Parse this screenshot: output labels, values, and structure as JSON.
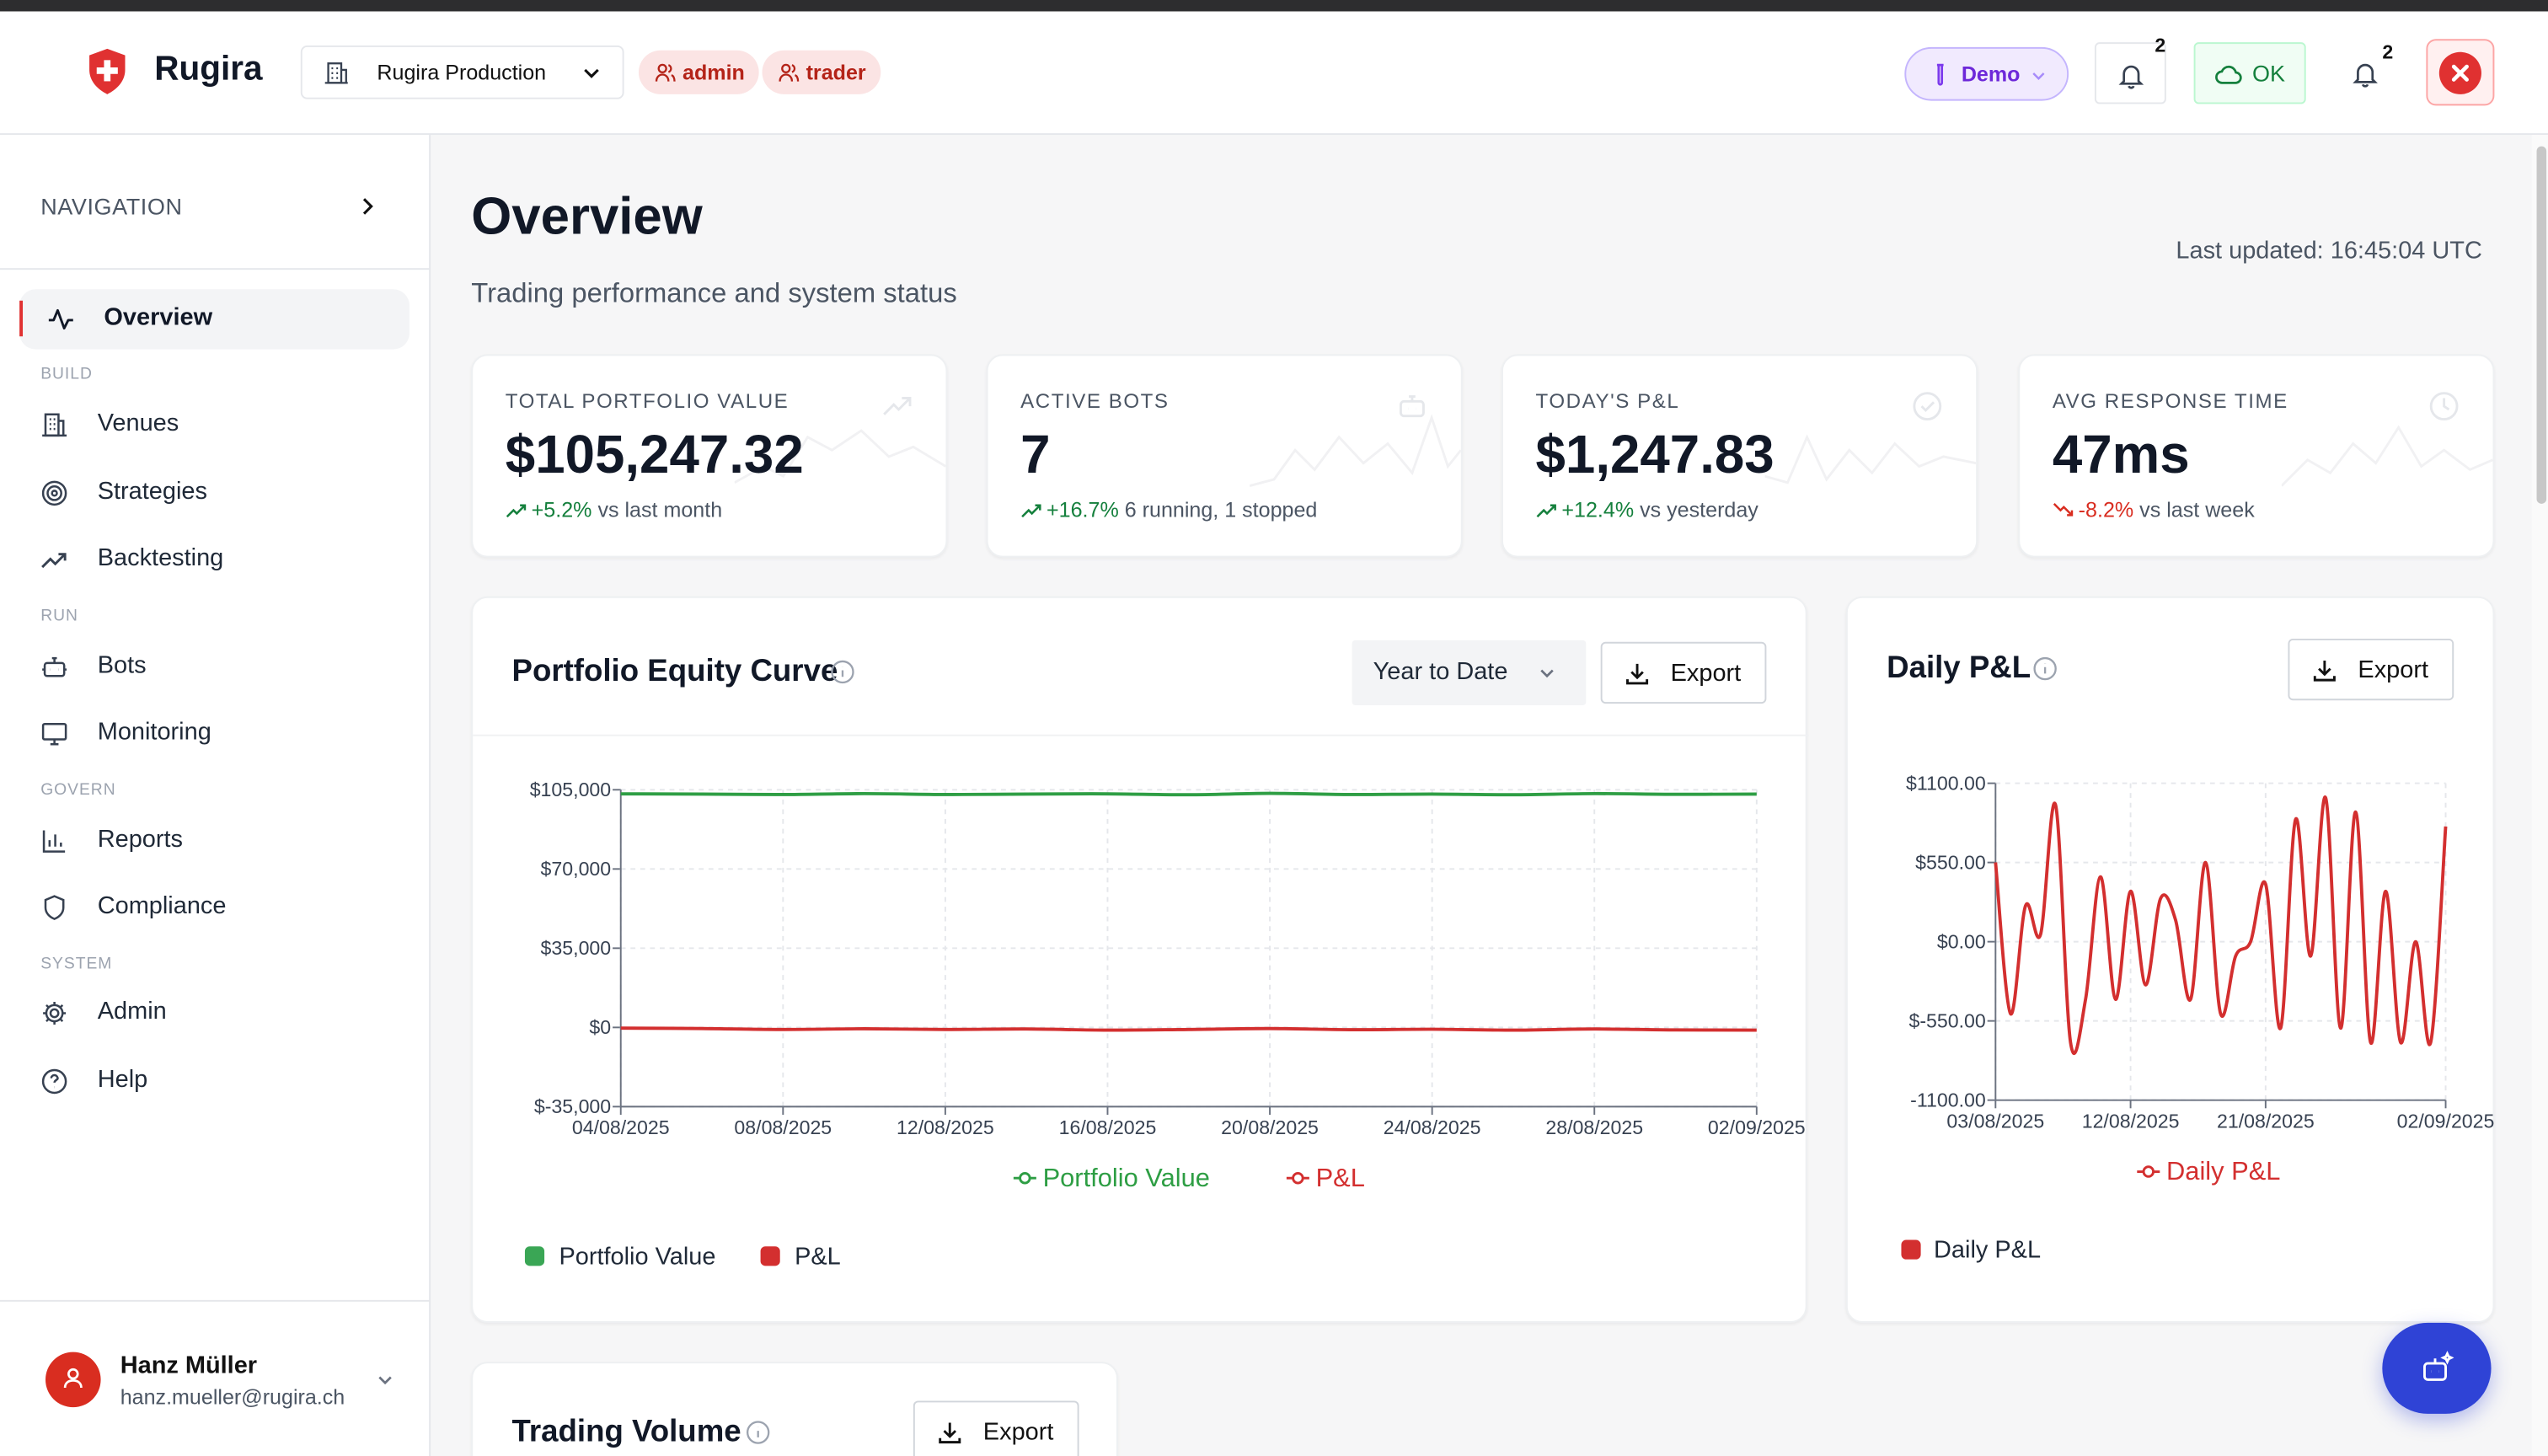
{
  "header": {
    "brand": "Rugira",
    "org": "Rugira Production",
    "roles": [
      "admin",
      "trader"
    ],
    "mode": "Demo",
    "notif_count": "2",
    "status": "OK",
    "notif_count_2": "2"
  },
  "sidebar": {
    "title": "NAVIGATION",
    "active": "Overview",
    "sections": {
      "build": "BUILD",
      "run": "RUN",
      "govern": "GOVERN",
      "system": "SYSTEM"
    },
    "items": [
      "Overview",
      "Venues",
      "Strategies",
      "Backtesting",
      "Bots",
      "Monitoring",
      "Reports",
      "Compliance",
      "Admin",
      "Help"
    ],
    "user": {
      "name": "Hanz Müller",
      "email": "hanz.mueller@rugira.ch"
    }
  },
  "page": {
    "title": "Overview",
    "subtitle": "Trading performance and system status",
    "last_updated": "Last updated: 16:45:04 UTC"
  },
  "stats": [
    {
      "label": "TOTAL PORTFOLIO VALUE",
      "value": "$105,247.32",
      "change": "+5.2%",
      "note": "vs last month",
      "direction": "up"
    },
    {
      "label": "ACTIVE BOTS",
      "value": "7",
      "change": "+16.7%",
      "note": "6 running, 1 stopped",
      "direction": "up"
    },
    {
      "label": "TODAY'S P&L",
      "value": "$1,247.83",
      "change": "+12.4%",
      "note": "vs yesterday",
      "direction": "up"
    },
    {
      "label": "AVG RESPONSE TIME",
      "value": "47ms",
      "change": "-8.2%",
      "note": "vs last week",
      "direction": "down"
    }
  ],
  "equity": {
    "title": "Portfolio Equity Curve",
    "range": "Year to Date",
    "export": "Export",
    "legend": [
      "Portfolio Value",
      "P&L"
    ]
  },
  "daily": {
    "title": "Daily P&L",
    "export": "Export",
    "legend": "Daily P&L"
  },
  "volume": {
    "title": "Trading Volume",
    "export": "Export"
  },
  "colors": {
    "accent": "#e03131",
    "green": "#2e9e44",
    "red": "#d32f2f",
    "fab": "#2f43d6"
  },
  "chart_data": [
    {
      "type": "line",
      "title": "Portfolio Equity Curve",
      "x": [
        "04/08/2025",
        "06/08/2025",
        "08/08/2025",
        "10/08/2025",
        "12/08/2025",
        "14/08/2025",
        "16/08/2025",
        "18/08/2025",
        "20/08/2025",
        "22/08/2025",
        "24/08/2025",
        "26/08/2025",
        "28/08/2025",
        "30/08/2025",
        "02/09/2025"
      ],
      "x_ticks": [
        "04/08/2025",
        "08/08/2025",
        "12/08/2025",
        "16/08/2025",
        "20/08/2025",
        "24/08/2025",
        "28/08/2025",
        "02/09/2025"
      ],
      "y_ticks": [
        "$105,000",
        "$70,000",
        "$35,000",
        "$0",
        "$-35,000"
      ],
      "ylim": [
        -35000,
        105000
      ],
      "series": [
        {
          "name": "Portfolio Value",
          "color": "#2e9e44",
          "values": [
            103200,
            103100,
            102900,
            103300,
            102900,
            103100,
            103200,
            102800,
            103400,
            102900,
            103100,
            102800,
            103300,
            103000,
            103100
          ]
        },
        {
          "name": "P&L",
          "color": "#d32f2f",
          "values": [
            -300,
            -500,
            -900,
            -600,
            -900,
            -700,
            -1200,
            -900,
            -500,
            -1000,
            -800,
            -1200,
            -700,
            -1100,
            -1200
          ]
        }
      ],
      "legend_top": [
        "Portfolio Value",
        "P&L"
      ]
    },
    {
      "type": "line",
      "title": "Daily P&L",
      "x": [
        "03/08/2025",
        "04/08/2025",
        "05/08/2025",
        "06/08/2025",
        "07/08/2025",
        "08/08/2025",
        "09/08/2025",
        "10/08/2025",
        "11/08/2025",
        "12/08/2025",
        "13/08/2025",
        "14/08/2025",
        "15/08/2025",
        "16/08/2025",
        "17/08/2025",
        "18/08/2025",
        "19/08/2025",
        "20/08/2025",
        "21/08/2025",
        "22/08/2025",
        "23/08/2025",
        "24/08/2025",
        "25/08/2025",
        "26/08/2025",
        "27/08/2025",
        "28/08/2025",
        "29/08/2025",
        "30/08/2025",
        "31/08/2025",
        "01/09/2025",
        "02/09/2025"
      ],
      "x_ticks": [
        "03/08/2025",
        "12/08/2025",
        "21/08/2025",
        "02/09/2025"
      ],
      "y_ticks": [
        "$1100.00",
        "$550.00",
        "$0.00",
        "$-550.00",
        "-1100.00"
      ],
      "ylim": [
        -1100,
        1100
      ],
      "series": [
        {
          "name": "Daily P&L",
          "color": "#d32f2f",
          "values": [
            550,
            -500,
            250,
            50,
            950,
            -700,
            -400,
            450,
            -400,
            350,
            -300,
            300,
            150,
            -400,
            550,
            -500,
            -100,
            0,
            400,
            -600,
            850,
            -100,
            1000,
            -600,
            900,
            -700,
            350,
            -700,
            0,
            -700,
            800
          ]
        }
      ],
      "legend_top": [
        "Daily P&L"
      ]
    }
  ]
}
